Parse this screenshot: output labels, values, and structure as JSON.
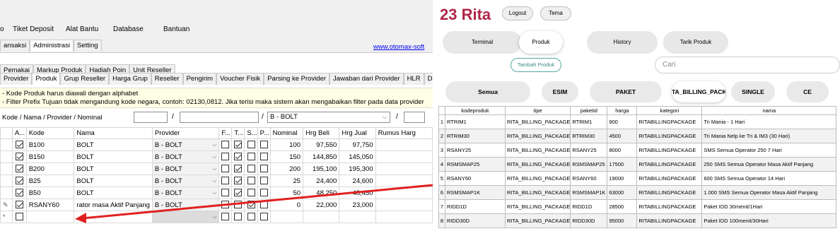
{
  "app": {
    "menu": [
      "o",
      "Tiket Deposit",
      "Alat Bantu",
      "Database",
      "Bantuan"
    ],
    "tabs1": [
      "ansaksi",
      "Administrasi",
      "Setting"
    ],
    "tabs1_active": 1,
    "link": "www.otomax-soft",
    "tabs2": [
      "Pemakai",
      "Markup Produk",
      "Hadiah Poin",
      "Unit Reseller"
    ],
    "tabs3": [
      "Provider",
      "Produk",
      "Grup Reseller",
      "Harga Grup",
      "Reseller",
      "Pengirim",
      "Voucher Fisik",
      "Parsing ke Provider",
      "Jawaban dari Provider",
      "HLR",
      "Daft"
    ],
    "tabs3_active": 1,
    "notes": [
      "- Kode Produk harus diawali dengan alphabet",
      "- Filter Prefix Tujuan tidak mengandung kode negara, contoh: 02130,0812. Jika terisi maka sistem akan mengabaikan filter pada data provider"
    ],
    "filter_label": "Kode / Nama / Provider / Nominal",
    "filter_value": "B - BOLT",
    "columns": [
      "A...",
      "Kode",
      "Nama",
      "Provider",
      "F...",
      "T...",
      "S...",
      "P...",
      "Nominal",
      "Hrg Beli",
      "Hrg Jual",
      "Rumus Harg"
    ],
    "rows": [
      {
        "mark": "",
        "active": true,
        "kode": "B100",
        "nama": "BOLT",
        "provider": "B - BOLT",
        "f": false,
        "t": true,
        "s": false,
        "p": false,
        "nominal": "100",
        "beli": "97,550",
        "jual": "97,750"
      },
      {
        "mark": "",
        "active": true,
        "kode": "B150",
        "nama": "BOLT",
        "provider": "B - BOLT",
        "f": false,
        "t": true,
        "s": false,
        "p": false,
        "nominal": "150",
        "beli": "144,850",
        "jual": "145,050"
      },
      {
        "mark": "",
        "active": true,
        "kode": "B200",
        "nama": "BOLT",
        "provider": "B - BOLT",
        "f": false,
        "t": true,
        "s": false,
        "p": false,
        "nominal": "200",
        "beli": "195,100",
        "jual": "195,300"
      },
      {
        "mark": "",
        "active": true,
        "kode": "B25",
        "nama": "BOLT",
        "provider": "B - BOLT",
        "f": false,
        "t": true,
        "s": false,
        "p": false,
        "nominal": "25",
        "beli": "24,400",
        "jual": "24,600"
      },
      {
        "mark": "",
        "active": true,
        "kode": "B50",
        "nama": "BOLT",
        "provider": "B - BOLT",
        "f": false,
        "t": true,
        "s": false,
        "p": false,
        "nominal": "50",
        "beli": "48,250",
        "jual": "48,450"
      },
      {
        "mark": "✎",
        "active": true,
        "kode": "RSANY60",
        "nama": "rator masa Aktif Panjang",
        "provider": "B - BOLT",
        "f": false,
        "t": false,
        "s": true,
        "p": false,
        "nominal": "0",
        "beli": "22,000",
        "jual": "23,000"
      },
      {
        "mark": "*",
        "active": false,
        "kode": "",
        "nama": "",
        "provider": "",
        "f": false,
        "t": false,
        "s": false,
        "p": false,
        "nominal": "",
        "beli": "",
        "jual": ""
      }
    ]
  },
  "web": {
    "title": "23 Rita",
    "logout": "Logout",
    "tema": "Tema",
    "nav": [
      "Terminal",
      "Produk",
      "History",
      "Tarik Produk"
    ],
    "nav_active": 1,
    "tambah": "Tambah Produk",
    "search_placeholder": "Cari",
    "categories": [
      "Semua",
      "ESIM",
      "PAKET",
      "TA_BILLING_PACKA",
      "SINGLE",
      "CE"
    ],
    "categories_active": 3,
    "columns": [
      "kodeproduk",
      "tipe",
      "paketid",
      "harga",
      "kategori",
      "nama"
    ],
    "rows": [
      [
        "1",
        "RTRIM1",
        "RITA_BILLING_PACKAGE",
        "RTRIM1",
        "900",
        "RITABILLINGPACKAGE",
        "Tri Mania - 1 Hari"
      ],
      [
        "2",
        "RTRIM30",
        "RITA_BILLING_PACKAGE",
        "RTRIM30",
        "4500",
        "RITABILLINGPACKAGE",
        "Tri Mania Nelp ke Tri & IM3 (30 Hari)"
      ],
      [
        "3",
        "RSANY25",
        "RITA_BILLING_PACKAGE",
        "RSANY25",
        "8000",
        "RITABILLINGPACKAGE",
        "SMS Semua Operator 250 7 Hari"
      ],
      [
        "4",
        "RSMSMAP25",
        "RITA_BILLING_PACKAGE",
        "RSMSMAP25",
        "17500",
        "RITABILLINGPACKAGE",
        "250 SMS Semua Operator Masa Aktif Panjang"
      ],
      [
        "5",
        "RSANY60",
        "RITA_BILLING_PACKAGE",
        "RSANY60",
        "19000",
        "RITABILLINGPACKAGE",
        "600 SMS Semua Operator 14 Hari"
      ],
      [
        "6",
        "RSMSMAP1K",
        "RITA_BILLING_PACKAGE",
        "RSMSMAP1K",
        "63000",
        "RITABILLINGPACKAGE",
        "1.000 SMS Semua Operator Masa Aktif Panjang"
      ],
      [
        "7",
        "RIDD1D",
        "RITA_BILLING_PACKAGE",
        "RIDD1D",
        "28500",
        "RITABILLINGPACKAGE",
        "Paket IDD 30menit/1Hari"
      ],
      [
        "8",
        "RIDD30D",
        "RITA_BILLING_PACKAGE",
        "RIDD30D",
        "95000",
        "RITABILLINGPACKAGE",
        "Paket IDD 100menit/30Hari"
      ]
    ]
  },
  "colors": {
    "title": "#b02648",
    "arrow": "#e02020",
    "accent": "#54a9a3",
    "link": "#0000ee"
  }
}
